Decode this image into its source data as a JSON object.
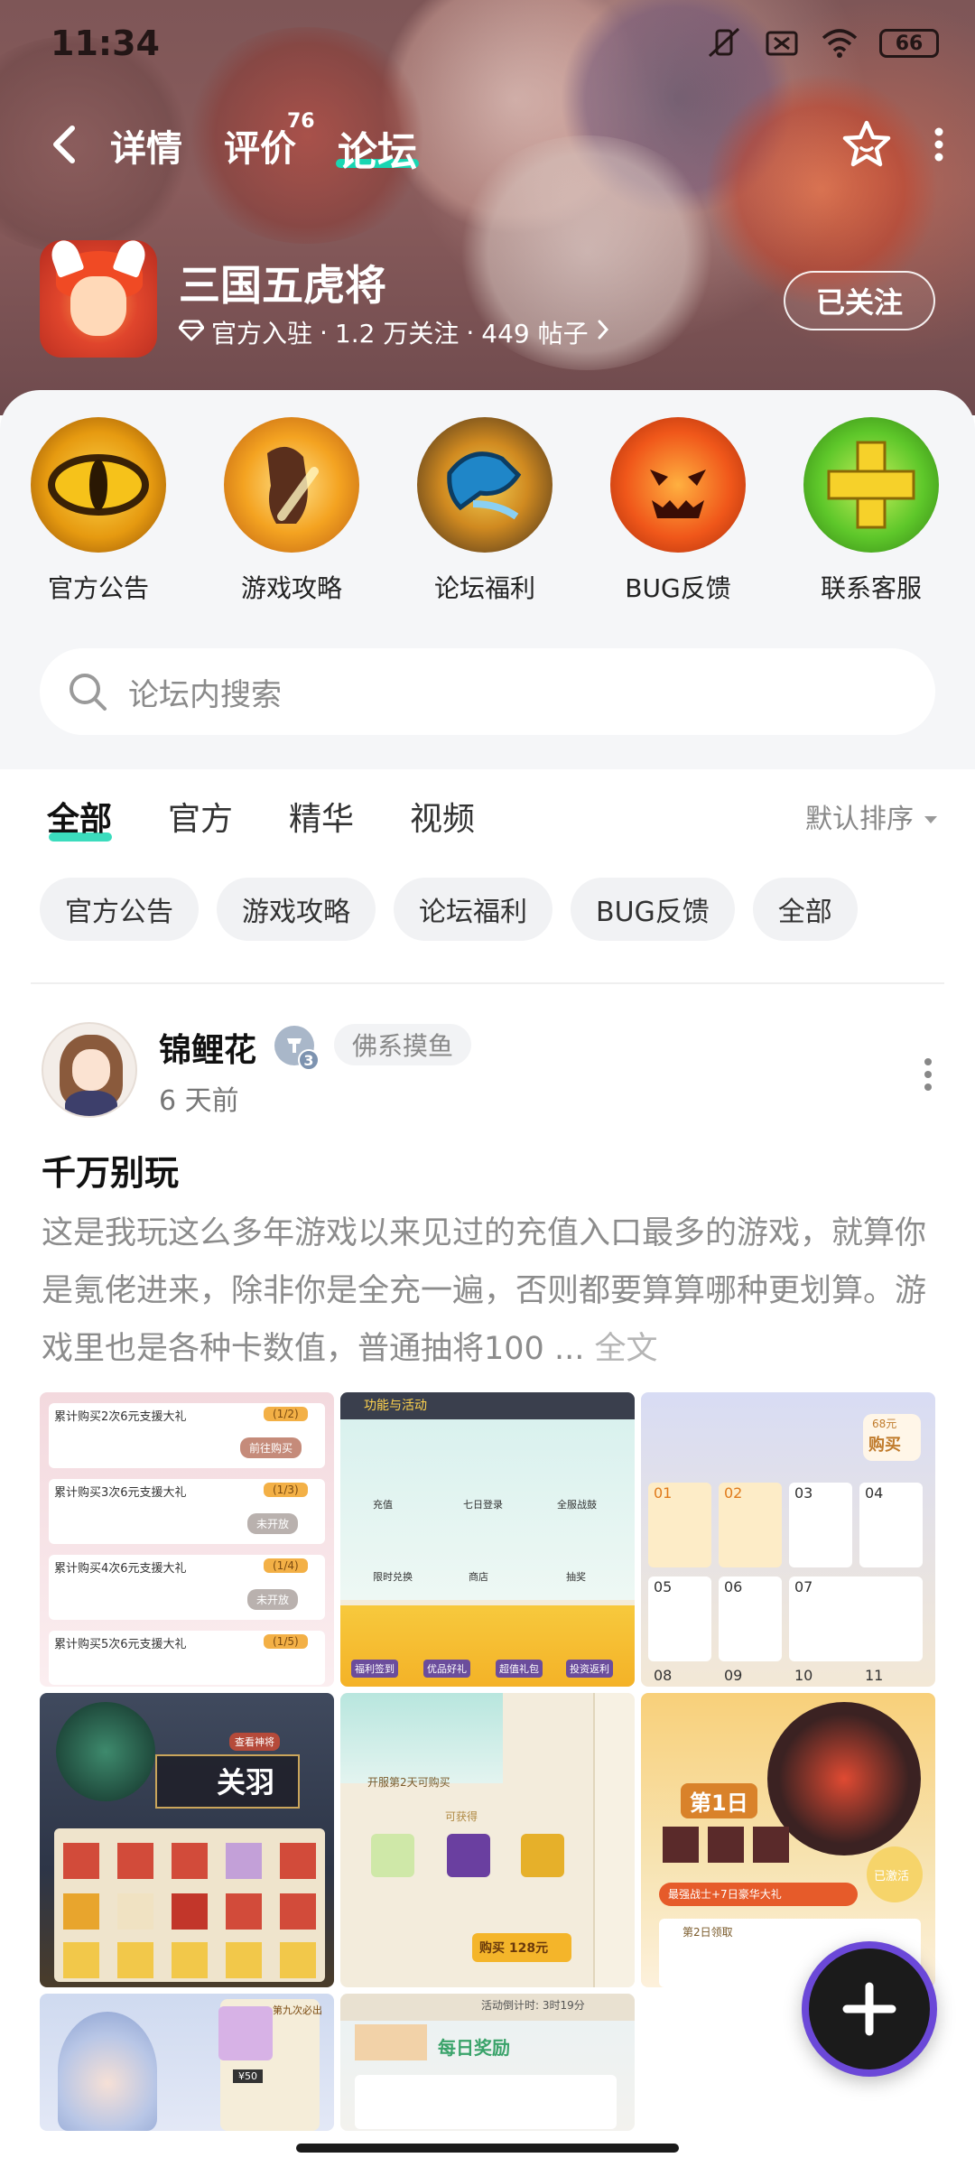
{
  "status_bar": {
    "time": "11:34",
    "battery": "66"
  },
  "nav": {
    "tabs": [
      {
        "label": "详情"
      },
      {
        "label": "评价",
        "badge": "76"
      },
      {
        "label": "论坛",
        "active": true
      }
    ]
  },
  "game": {
    "title": "三国五虎将",
    "meta_official": "官方入驻",
    "meta_followers": "1.2 万关注",
    "meta_posts": "449 帖子",
    "follow_label": "已关注"
  },
  "categories": [
    {
      "label": "官方公告",
      "icon": "dragon-eye-icon",
      "color": "#e8a71c"
    },
    {
      "label": "游戏攻略",
      "icon": "fist-icon",
      "color": "#f29320"
    },
    {
      "label": "论坛福利",
      "icon": "gift-hand-icon",
      "color": "#2f7fc2"
    },
    {
      "label": "BUG反馈",
      "icon": "pumpkin-icon",
      "color": "#f0571a"
    },
    {
      "label": "联系客服",
      "icon": "plus-cross-icon",
      "color": "#5ec72a"
    }
  ],
  "search": {
    "placeholder": "论坛内搜索"
  },
  "filters": {
    "tabs": [
      {
        "label": "全部",
        "active": true
      },
      {
        "label": "官方"
      },
      {
        "label": "精华"
      },
      {
        "label": "视频"
      }
    ],
    "sort_label": "默认排序"
  },
  "chips": [
    "官方公告",
    "游戏攻略",
    "论坛福利",
    "BUG反馈",
    "全部"
  ],
  "post": {
    "author": "锦鲤花",
    "level": "3",
    "tag": "佛系摸鱼",
    "time": "6 天前",
    "title": "千万别玩",
    "body": "这是我玩这么多年游戏以来见过的充值入口最多的游戏，就算你是氪佬进来，除非你是全充一遍，否则都要算算哪种更划算。游戏里也是各种卡数值，普通抽将100",
    "ellipsis": " ... ",
    "read_more": "全文",
    "images": [
      {
        "name": "recharge-gift-screenshot",
        "texts": [
          "累计购买2次6元支援大礼",
          "(1/2)",
          "前往购买",
          "累计购买3次6元支援大礼",
          "(1/3)",
          "未开放",
          "累计购买4次6元支援大礼",
          "(1/4)",
          "未开放",
          "累计购买5次6元支援大礼",
          "(1/5)"
        ]
      },
      {
        "name": "function-activity-screenshot",
        "texts": [
          "功能与活动",
          "充值",
          "七日登录",
          "全服战鼓",
          "限时兑换",
          "商店",
          "抽奖",
          "福利签到",
          "优品好礼",
          "超值礼包",
          "投资返利"
        ]
      },
      {
        "name": "daily-coin-screenshot",
        "texts": [
          "68元",
          "购买",
          "01",
          "02",
          "03",
          "04",
          "05",
          "06",
          "07",
          "08",
          "09",
          "10",
          "11"
        ]
      },
      {
        "name": "guanyu-hero-screenshot",
        "texts": [
          "关羽",
          "查看神将"
        ]
      },
      {
        "name": "day2-purchase-screenshot",
        "texts": [
          "开服第2天可购买",
          "可获得",
          "购买 128元"
        ]
      },
      {
        "name": "day1-reward-screenshot",
        "texts": [
          "第1日",
          "最强战士+7日豪华大礼",
          "已激活",
          "第2日领取"
        ]
      },
      {
        "name": "hero-chest-screenshot",
        "texts": [
          "第九次必出",
          "¥50"
        ]
      },
      {
        "name": "daily-reward-screenshot",
        "texts": [
          "活动倒计时: 3时19分",
          "每日奖励"
        ]
      }
    ]
  },
  "colors": {
    "accent": "#19d6b2",
    "hero_bg": "#7e5657",
    "fab_ring": "#6b48d8"
  }
}
